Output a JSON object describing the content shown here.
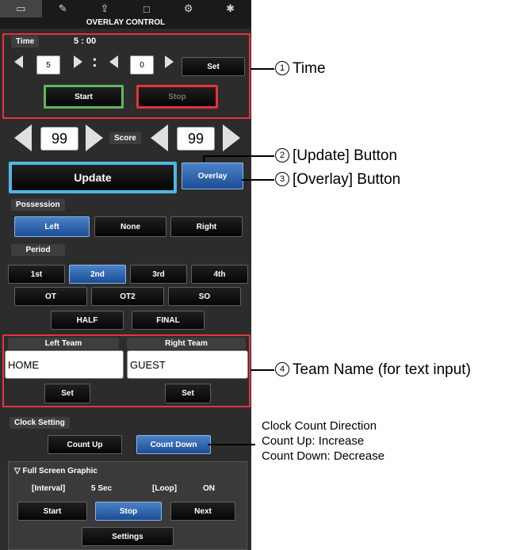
{
  "tabs": [
    {
      "icon": "monitor-icon",
      "active": true
    },
    {
      "icon": "edit-icon",
      "active": false
    },
    {
      "icon": "export-icon",
      "active": false
    },
    {
      "icon": "window-icon",
      "active": false
    },
    {
      "icon": "camera-settings-icon",
      "active": false
    },
    {
      "icon": "gear-icon",
      "active": false
    }
  ],
  "title": "OVERLAY CONTROL",
  "time": {
    "label": "Time",
    "display": "5 : 00",
    "minutes": "5",
    "colon": ":",
    "seconds": "0",
    "set": "Set",
    "start": "Start",
    "stop": "Stop"
  },
  "score": {
    "left": "99",
    "label": "Score",
    "right": "99"
  },
  "update": "Update",
  "overlay": "Overlay",
  "possession": {
    "label": "Possession",
    "options": [
      "Left",
      "None",
      "Right"
    ],
    "selected": "Left"
  },
  "period": {
    "label": "Period",
    "row1": [
      "1st",
      "2nd",
      "3rd",
      "4th"
    ],
    "row2": [
      "OT",
      "OT2",
      "SO"
    ],
    "row3": [
      "HALF",
      "FINAL"
    ],
    "selected": "2nd"
  },
  "teams": {
    "left_label": "Left Team",
    "right_label": "Right Team",
    "left_value": "HOME",
    "right_value": "GUEST",
    "set": "Set"
  },
  "clock": {
    "label": "Clock Setting",
    "up": "Count Up",
    "down": "Count Down",
    "selected": "Count Down"
  },
  "fsg": {
    "header": "▽ Full Screen Graphic",
    "interval_label": "[Interval]",
    "interval_value": "5 Sec",
    "loop_label": "[Loop]",
    "loop_value": "ON",
    "start": "Start",
    "stop": "Stop",
    "next": "Next",
    "settings": "Settings"
  },
  "callouts": {
    "c1": {
      "num": "1",
      "text": "Time"
    },
    "c2": {
      "num": "2",
      "text": "[Update] Button"
    },
    "c3": {
      "num": "3",
      "text": "[Overlay] Button"
    },
    "c4": {
      "num": "4",
      "text": "Team Name (for text input)"
    }
  },
  "note": {
    "line1": "Clock Count Direction",
    "line2": "Count Up: Increase",
    "line3": "Count Down: Decrease"
  },
  "colors": {
    "highlight_red": "#e8323c",
    "start_green": "#5cb85c",
    "stop_red": "#e8323c",
    "update_cyan": "#4fb8e0",
    "selected_blue": "#2a62ac"
  }
}
